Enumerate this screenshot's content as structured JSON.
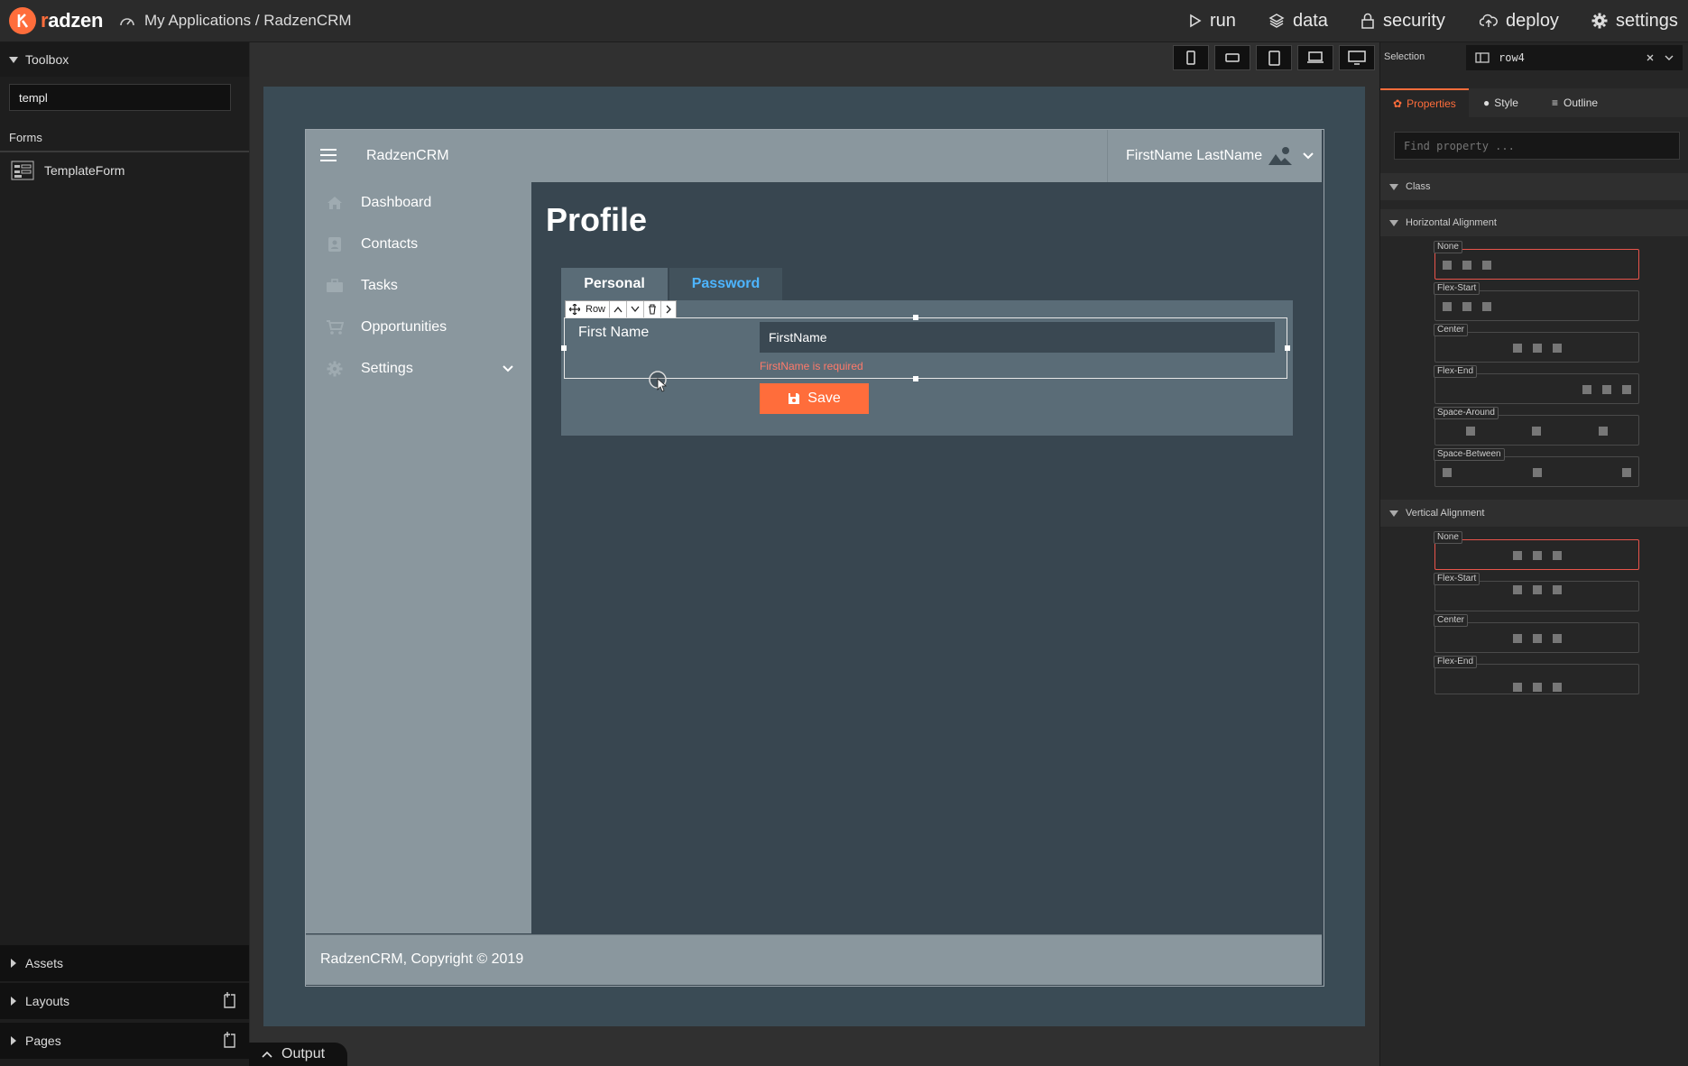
{
  "topbar": {
    "logo_text_r": "r",
    "logo_text": "adzen",
    "breadcrumb": "My Applications / RadzenCRM",
    "nav": [
      {
        "label": "run",
        "icon": "play-icon"
      },
      {
        "label": "data",
        "icon": "layers-icon"
      },
      {
        "label": "security",
        "icon": "lock-icon"
      },
      {
        "label": "deploy",
        "icon": "cloud-upload-icon"
      },
      {
        "label": "settings",
        "icon": "gear-icon"
      }
    ]
  },
  "toolbox": {
    "title": "Toolbox",
    "search_value": "templ",
    "category": "Forms",
    "items": [
      {
        "label": "TemplateForm",
        "icon": "template-form-icon"
      }
    ],
    "bottom_sections": [
      {
        "label": "Assets"
      },
      {
        "label": "Layouts"
      },
      {
        "label": "Pages"
      }
    ]
  },
  "app": {
    "name": "RadzenCRM",
    "user": "FirstName LastName",
    "nav": [
      {
        "label": "Dashboard",
        "icon": "home-icon"
      },
      {
        "label": "Contacts",
        "icon": "contact-card-icon"
      },
      {
        "label": "Tasks",
        "icon": "briefcase-icon"
      },
      {
        "label": "Opportunities",
        "icon": "cart-icon"
      },
      {
        "label": "Settings",
        "icon": "gear-icon"
      }
    ],
    "page_title": "Profile",
    "tabs": [
      {
        "label": "Personal",
        "active": true
      },
      {
        "label": "Password",
        "active": false
      }
    ],
    "row_toolbar_label": "Row",
    "form": {
      "first_name_label": "First Name",
      "first_name_value": "FirstName",
      "first_name_error": "FirstName is required",
      "save_label": "Save"
    },
    "footer": "RadzenCRM, Copyright © 2019"
  },
  "right_panel": {
    "selection_label": "Selection",
    "selection_value": "row4",
    "tabs": [
      {
        "label": "Properties",
        "active": true
      },
      {
        "label": "Style",
        "active": false
      },
      {
        "label": "Outline",
        "active": false
      }
    ],
    "find_placeholder": "Find property ...",
    "sections": {
      "class": "Class",
      "horizontal": "Horizontal Alignment",
      "vertical": "Vertical Alignment"
    },
    "horizontal_options": [
      "None",
      "Flex-Start",
      "Center",
      "Flex-End",
      "Space-Around",
      "Space-Between"
    ],
    "horizontal_selected": "None",
    "vertical_options": [
      "None",
      "Flex-Start",
      "Center",
      "Flex-End"
    ],
    "vertical_selected": "None"
  },
  "output_label": "Output",
  "colors": {
    "accent": "#ff6d3b",
    "link": "#4db5ff",
    "error": "#ff7a6a",
    "selected_border": "#e8544b"
  }
}
